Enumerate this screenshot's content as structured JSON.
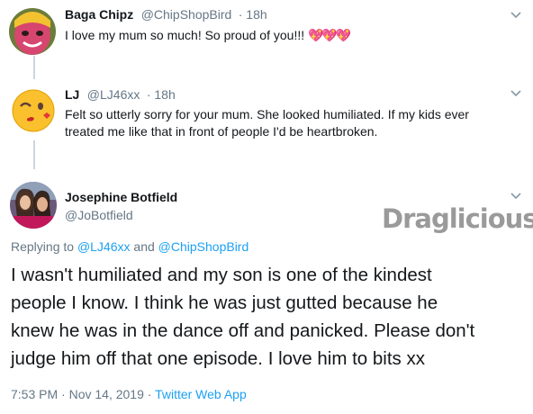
{
  "tweets": [
    {
      "display_name": "Baga Chipz",
      "handle": "@ChipShopBird",
      "time": "· 18h",
      "text": "I love my mum so much! So proud of you!!!",
      "emoji": "💖💖💖"
    },
    {
      "display_name": "LJ",
      "handle": "@LJ46xx",
      "time": "· 18h",
      "text_lines": [
        "Felt so utterly sorry for your mum. She looked humiliated. If my kids ever",
        "treated me like that in front of people I'd be heartbroken."
      ]
    }
  ],
  "main_tweet": {
    "display_name": "Josephine Botfield",
    "handle": "@JoBotfield",
    "replying_prefix": "Replying to",
    "replying_user1": "@LJ46xx",
    "replying_and": "and",
    "replying_user2": "@ChipShopBird",
    "text_lines": [
      "I wasn't humiliated and my son is one of the kindest",
      "people I know. I think he was just gutted because he",
      "knew he was in the dance off and panicked. Please don't",
      "judge him off that one episode. I love him to bits xx"
    ],
    "timestamp": "7:53 PM · Nov 14, 2019 ·",
    "source": "Twitter Web App"
  },
  "watermark": "Draglicious",
  "icons": {
    "menu": "chevron-down-icon",
    "emoji_reply": "winking-kiss-emoji-icon"
  },
  "colors": {
    "link": "#1da1f2",
    "muted": "#657786",
    "text": "#14171a",
    "thread_line": "#ccd6dd"
  }
}
